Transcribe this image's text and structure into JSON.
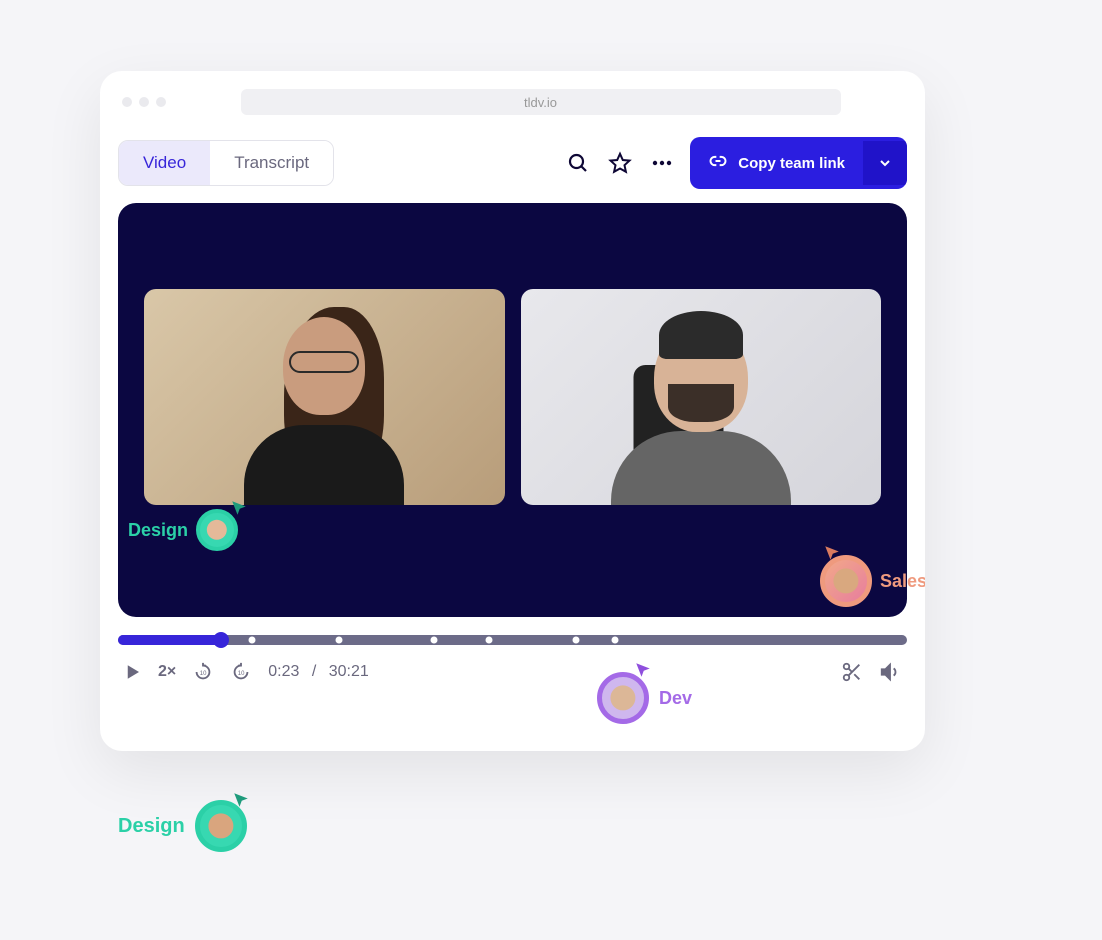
{
  "chrome": {
    "url": "tldv.io"
  },
  "toolbar": {
    "tabs": {
      "video": "Video",
      "transcript": "Transcript"
    },
    "copy_link_label": "Copy team link"
  },
  "player": {
    "speed_label": "2×",
    "current_time": "0:23",
    "time_separator": "/",
    "duration": "30:21",
    "progress_percent": 13,
    "markers_percent": [
      17,
      28,
      40,
      47,
      58,
      63
    ]
  },
  "cursors": {
    "design_in_video": {
      "label": "Design",
      "color": "#2bd0a7"
    },
    "sales": {
      "label": "Sales",
      "color": "#ef9a7e"
    },
    "dev": {
      "label": "Dev",
      "color": "#a46ae7"
    },
    "design_outside": {
      "label": "Design",
      "color": "#2bd0a7"
    }
  },
  "colors": {
    "accent": "#2b1ee0",
    "video_bg": "#0b0741",
    "progress_bg": "#6c6b88",
    "progress_fill": "#3725d9"
  }
}
